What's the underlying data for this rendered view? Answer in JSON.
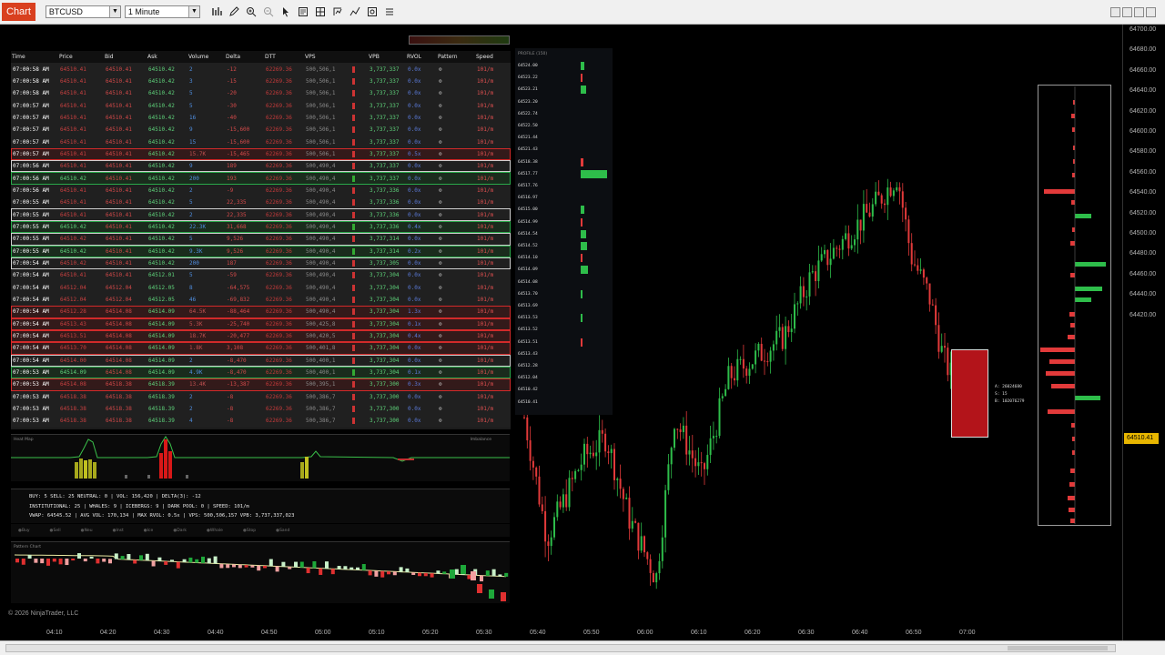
{
  "toolbar": {
    "tab_label": "Chart",
    "instrument": "BTCUSD",
    "interval": "1 Minute",
    "icons": [
      "bar-chart-icon",
      "pencil-icon",
      "zoom-in-icon",
      "zoom-out-icon",
      "cursor-icon",
      "data-box-icon",
      "crosshair-icon",
      "strategy-icon",
      "indicator-icon",
      "properties-icon",
      "list-icon"
    ]
  },
  "tns": {
    "headers": [
      "Time",
      "Price",
      "Bid",
      "Ask",
      "Volume",
      "Delta",
      "DTT",
      "VPS",
      "VPB",
      "RVOL",
      "Pattern",
      "Speed"
    ],
    "rows": [
      {
        "t": "07:00:58 AM",
        "p": "64510.41",
        "b": "64510.41",
        "a": "64510.42",
        "v": "2",
        "d": "-12",
        "dtt": "62269.36",
        "vps": "500,506,1",
        "vpb": "3,737,337",
        "r": "0.0x",
        "s": "101/m",
        "hl": ""
      },
      {
        "t": "07:00:58 AM",
        "p": "64510.41",
        "b": "64510.41",
        "a": "64510.42",
        "v": "3",
        "d": "-15",
        "dtt": "62269.36",
        "vps": "500,506,1",
        "vpb": "3,737,337",
        "r": "0.0x",
        "s": "101/m",
        "hl": ""
      },
      {
        "t": "07:00:58 AM",
        "p": "64510.41",
        "b": "64510.41",
        "a": "64510.42",
        "v": "5",
        "d": "-20",
        "dtt": "62269.36",
        "vps": "500,506,1",
        "vpb": "3,737,337",
        "r": "0.0x",
        "s": "101/m",
        "hl": ""
      },
      {
        "t": "07:00:57 AM",
        "p": "64510.41",
        "b": "64510.41",
        "a": "64510.42",
        "v": "5",
        "d": "-30",
        "dtt": "62269.36",
        "vps": "500,506,1",
        "vpb": "3,737,337",
        "r": "0.0x",
        "s": "101/m",
        "hl": ""
      },
      {
        "t": "07:00:57 AM",
        "p": "64510.41",
        "b": "64510.41",
        "a": "64510.42",
        "v": "16",
        "d": "-40",
        "dtt": "62269.36",
        "vps": "500,506,1",
        "vpb": "3,737,337",
        "r": "0.0x",
        "s": "101/m",
        "hl": ""
      },
      {
        "t": "07:00:57 AM",
        "p": "64510.41",
        "b": "64510.41",
        "a": "64510.42",
        "v": "9",
        "d": "-15,600",
        "dtt": "62269.36",
        "vps": "500,506,1",
        "vpb": "3,737,337",
        "r": "0.0x",
        "s": "101/m",
        "hl": ""
      },
      {
        "t": "07:00:57 AM",
        "p": "64510.41",
        "b": "64510.41",
        "a": "64510.42",
        "v": "15",
        "d": "-15,600",
        "dtt": "62269.36",
        "vps": "500,506,1",
        "vpb": "3,737,337",
        "r": "0.0x",
        "s": "101/m",
        "hl": ""
      },
      {
        "t": "07:00:57 AM",
        "p": "64510.41",
        "b": "64510.41",
        "a": "64510.42",
        "v": "15.7K",
        "d": "-15,465",
        "dtt": "62269.36",
        "vps": "500,506,1",
        "vpb": "3,737,337",
        "r": "0.5x",
        "s": "101/m",
        "hl": "red"
      },
      {
        "t": "07:00:56 AM",
        "p": "64510.41",
        "b": "64510.41",
        "a": "64510.42",
        "v": "9",
        "d": "189",
        "dtt": "62269.36",
        "vps": "500,490,4",
        "vpb": "3,737,337",
        "r": "0.0x",
        "s": "101/m",
        "hl": "white"
      },
      {
        "t": "07:00:56 AM",
        "p": "64510.42",
        "b": "64510.41",
        "a": "64510.42",
        "v": "200",
        "d": "193",
        "dtt": "62269.36",
        "vps": "500,490,4",
        "vpb": "3,737,337",
        "r": "0.0x",
        "s": "101/m",
        "hl": "green"
      },
      {
        "t": "07:00:56 AM",
        "p": "64510.41",
        "b": "64510.41",
        "a": "64510.42",
        "v": "2",
        "d": "-9",
        "dtt": "62269.36",
        "vps": "500,490,4",
        "vpb": "3,737,336",
        "r": "0.0x",
        "s": "101/m",
        "hl": ""
      },
      {
        "t": "07:00:55 AM",
        "p": "64510.41",
        "b": "64510.41",
        "a": "64510.42",
        "v": "5",
        "d": "22,335",
        "dtt": "62269.36",
        "vps": "500,490,4",
        "vpb": "3,737,336",
        "r": "0.0x",
        "s": "101/m",
        "hl": ""
      },
      {
        "t": "07:00:55 AM",
        "p": "64510.41",
        "b": "64510.41",
        "a": "64510.42",
        "v": "2",
        "d": "22,335",
        "dtt": "62269.36",
        "vps": "500,490,4",
        "vpb": "3,737,336",
        "r": "0.0x",
        "s": "101/m",
        "hl": "white"
      },
      {
        "t": "07:00:55 AM",
        "p": "64510.42",
        "b": "64510.41",
        "a": "64510.42",
        "v": "22.3K",
        "d": "31,668",
        "dtt": "62269.36",
        "vps": "500,490,4",
        "vpb": "3,737,336",
        "r": "0.4x",
        "s": "101/m",
        "hl": "green"
      },
      {
        "t": "07:00:55 AM",
        "p": "64510.42",
        "b": "64510.41",
        "a": "64510.42",
        "v": "5",
        "d": "9,526",
        "dtt": "62269.36",
        "vps": "500,490,4",
        "vpb": "3,737,314",
        "r": "0.0x",
        "s": "101/m",
        "hl": "white"
      },
      {
        "t": "07:00:55 AM",
        "p": "64510.42",
        "b": "64510.41",
        "a": "64510.42",
        "v": "9.3K",
        "d": "9,526",
        "dtt": "62269.36",
        "vps": "500,490,4",
        "vpb": "3,737,314",
        "r": "0.2x",
        "s": "101/m",
        "hl": "green"
      },
      {
        "t": "07:00:54 AM",
        "p": "64510.42",
        "b": "64510.41",
        "a": "64510.42",
        "v": "200",
        "d": "187",
        "dtt": "62269.36",
        "vps": "500,490,4",
        "vpb": "3,737,305",
        "r": "0.0x",
        "s": "101/m",
        "hl": "white"
      },
      {
        "t": "07:00:54 AM",
        "p": "64510.41",
        "b": "64510.41",
        "a": "64512.01",
        "v": "5",
        "d": "-59",
        "dtt": "62269.36",
        "vps": "500,490,4",
        "vpb": "3,737,304",
        "r": "0.0x",
        "s": "101/m",
        "hl": ""
      },
      {
        "t": "07:00:54 AM",
        "p": "64512.04",
        "b": "64512.04",
        "a": "64512.05",
        "v": "8",
        "d": "-64,575",
        "dtt": "62269.36",
        "vps": "500,490,4",
        "vpb": "3,737,304",
        "r": "0.0x",
        "s": "101/m",
        "hl": ""
      },
      {
        "t": "07:00:54 AM",
        "p": "64512.04",
        "b": "64512.04",
        "a": "64512.05",
        "v": "46",
        "d": "-69,832",
        "dtt": "62269.36",
        "vps": "500,490,4",
        "vpb": "3,737,304",
        "r": "0.0x",
        "s": "101/m",
        "hl": ""
      },
      {
        "t": "07:00:54 AM",
        "p": "64512.28",
        "b": "64514.08",
        "a": "64514.09",
        "v": "64.5K",
        "d": "-88,464",
        "dtt": "62269.36",
        "vps": "500,490,4",
        "vpb": "3,737,304",
        "r": "1.3x",
        "s": "101/m",
        "hl": "red"
      },
      {
        "t": "07:00:54 AM",
        "p": "64513.43",
        "b": "64514.08",
        "a": "64514.09",
        "v": "5.3K",
        "d": "-25,740",
        "dtt": "62269.36",
        "vps": "500,425,8",
        "vpb": "3,737,304",
        "r": "0.1x",
        "s": "101/m",
        "hl": "red"
      },
      {
        "t": "07:00:54 AM",
        "p": "64513.51",
        "b": "64514.08",
        "a": "64514.09",
        "v": "18.7K",
        "d": "-20,477",
        "dtt": "62269.36",
        "vps": "500,420,5",
        "vpb": "3,737,304",
        "r": "0.4x",
        "s": "101/m",
        "hl": "red"
      },
      {
        "t": "07:00:54 AM",
        "p": "64513.70",
        "b": "64514.08",
        "a": "64514.09",
        "v": "1.8K",
        "d": "3,108",
        "dtt": "62269.36",
        "vps": "500,401,8",
        "vpb": "3,737,304",
        "r": "0.0x",
        "s": "101/m",
        "hl": "red"
      },
      {
        "t": "07:00:54 AM",
        "p": "64514.00",
        "b": "64514.08",
        "a": "64514.09",
        "v": "2",
        "d": "-8,470",
        "dtt": "62269.36",
        "vps": "500,400,1",
        "vpb": "3,737,304",
        "r": "0.0x",
        "s": "101/m",
        "hl": "white"
      },
      {
        "t": "07:00:53 AM",
        "p": "64514.09",
        "b": "64514.08",
        "a": "64514.09",
        "v": "4.9K",
        "d": "-8,470",
        "dtt": "62269.36",
        "vps": "500,400,1",
        "vpb": "3,737,304",
        "r": "0.1x",
        "s": "101/m",
        "hl": "green"
      },
      {
        "t": "07:00:53 AM",
        "p": "64514.08",
        "b": "64518.38",
        "a": "64518.39",
        "v": "13.4K",
        "d": "-13,387",
        "dtt": "62269.36",
        "vps": "500,395,1",
        "vpb": "3,737,300",
        "r": "0.3x",
        "s": "101/m",
        "hl": "red"
      },
      {
        "t": "07:00:53 AM",
        "p": "64518.38",
        "b": "64518.38",
        "a": "64518.39",
        "v": "2",
        "d": "-8",
        "dtt": "62269.36",
        "vps": "500,386,7",
        "vpb": "3,737,300",
        "r": "0.0x",
        "s": "101/m",
        "hl": ""
      },
      {
        "t": "07:00:53 AM",
        "p": "64518.38",
        "b": "64518.38",
        "a": "64518.39",
        "v": "2",
        "d": "-8",
        "dtt": "62269.36",
        "vps": "500,386,7",
        "vpb": "3,737,300",
        "r": "0.0x",
        "s": "101/m",
        "hl": ""
      },
      {
        "t": "07:00:53 AM",
        "p": "64518.38",
        "b": "64518.38",
        "a": "64518.39",
        "v": "4",
        "d": "-8",
        "dtt": "62269.36",
        "vps": "500,386,7",
        "vpb": "3,737,300",
        "r": "0.0x",
        "s": "101/m",
        "hl": ""
      }
    ]
  },
  "heatmap": {
    "left_label": "Heat Map",
    "right_label": "Imbalance"
  },
  "summary": {
    "line1": "BUY: 5  SELL: 25  NEUTRAL: 0  |  VOL: 156,420  |  DELTA(3): -12",
    "line2": "INSTITUTIONAL: 25  |  WHALES: 9  |  ICEBERGS: 9  |  DARK POOL: 0  |  SPEED: 101/m",
    "line3": "VWAP: 64545.52  |  AVG VOL: 170,134  |  MAX RVOL: 0.5x  |  VPS: 500,506,157  VPB: 3,737,337,023"
  },
  "legend": [
    "Buy",
    "Sell",
    "Neu",
    "Inst",
    "Ice",
    "Dark",
    "Whale",
    "Stop",
    "Sand"
  ],
  "pattern": {
    "label": "Pattern Chart"
  },
  "profile": {
    "title": "PROFILE (150)",
    "levels": [
      {
        "price": "64524.00",
        "side": "g",
        "vol": 0.12
      },
      {
        "price": "64523.22",
        "side": "r",
        "vol": 0.03
      },
      {
        "price": "64523.21",
        "side": "g",
        "vol": 0.2
      },
      {
        "price": "64523.20",
        "side": "",
        "vol": 0
      },
      {
        "price": "64522.74",
        "side": "",
        "vol": 0
      },
      {
        "price": "64522.50",
        "side": "",
        "vol": 0
      },
      {
        "price": "64521.44",
        "side": "",
        "vol": 0
      },
      {
        "price": "64521.43",
        "side": "",
        "vol": 0
      },
      {
        "price": "64518.38",
        "side": "r",
        "vol": 0.1
      },
      {
        "price": "64517.77",
        "side": "g",
        "vol": 0.95
      },
      {
        "price": "64517.76",
        "side": "",
        "vol": 0
      },
      {
        "price": "64516.97",
        "side": "",
        "vol": 0
      },
      {
        "price": "64515.00",
        "side": "g",
        "vol": 0.12
      },
      {
        "price": "64514.99",
        "side": "r",
        "vol": 0.04
      },
      {
        "price": "64514.54",
        "side": "g",
        "vol": 0.2
      },
      {
        "price": "64514.52",
        "side": "g",
        "vol": 0.22
      },
      {
        "price": "64514.10",
        "side": "r",
        "vol": 0.05
      },
      {
        "price": "64514.09",
        "side": "g",
        "vol": 0.25
      },
      {
        "price": "64514.08",
        "side": "",
        "vol": 0
      },
      {
        "price": "64513.70",
        "side": "g",
        "vol": 0.08
      },
      {
        "price": "64513.69",
        "side": "",
        "vol": 0
      },
      {
        "price": "64513.53",
        "side": "g",
        "vol": 0.04
      },
      {
        "price": "64513.52",
        "side": "",
        "vol": 0
      },
      {
        "price": "64513.51",
        "side": "r",
        "vol": 0.03
      },
      {
        "price": "64513.43",
        "side": "",
        "vol": 0
      },
      {
        "price": "64512.28",
        "side": "",
        "vol": 0
      },
      {
        "price": "64512.04",
        "side": "",
        "vol": 0
      },
      {
        "price": "64510.42",
        "side": "",
        "vol": 0
      },
      {
        "price": "64510.41",
        "side": "",
        "vol": 0
      }
    ]
  },
  "price_axis": {
    "ticks": [
      "64700.00",
      "64680.00",
      "64660.00",
      "64640.00",
      "64620.00",
      "64600.00",
      "64580.00",
      "64560.00",
      "64540.00",
      "64520.00",
      "64500.00",
      "64480.00",
      "64460.00",
      "64440.00",
      "64420.00"
    ],
    "last_price": "64510.41"
  },
  "time_axis": [
    "04:10",
    "04:20",
    "04:30",
    "04:40",
    "04:50",
    "05:00",
    "05:10",
    "05:20",
    "05:30",
    "05:40",
    "05:50",
    "06:00",
    "06:10",
    "06:20",
    "06:30",
    "06:40",
    "06:50",
    "07:00"
  ],
  "ask_info": {
    "a": "A: 26024680",
    "s": "S: 15",
    "b": "B: 102076279"
  },
  "copyright": "© 2026 NinjaTrader, LLC",
  "colors": {
    "up": "#2ebd4a",
    "down": "#e23a3a",
    "accent": "#d9401f",
    "flag": "#e8b600"
  }
}
